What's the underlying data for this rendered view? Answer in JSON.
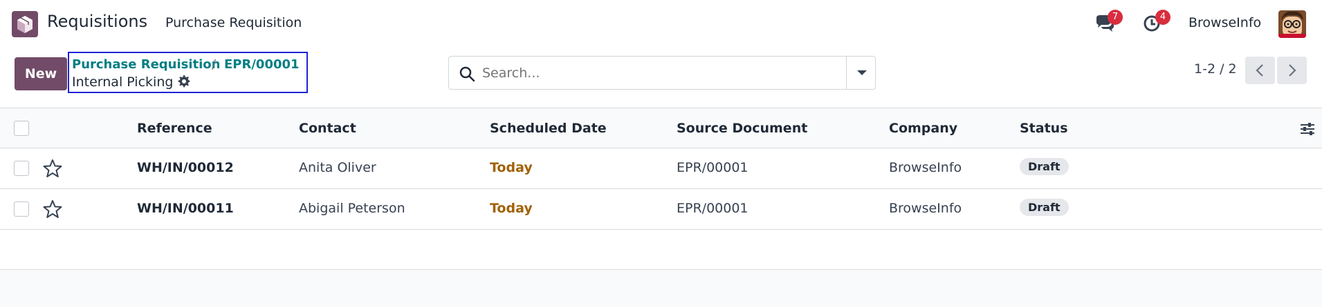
{
  "navbar": {
    "app_name": "Requisitions",
    "menu_item": "Purchase Requisition",
    "messages_count": "7",
    "activities_count": "4",
    "user_name": "BrowseInfo",
    "logo_icon": "cube-box-icon",
    "colors": {
      "brand": "#714b67",
      "badge": "#d92d3e"
    }
  },
  "control_panel": {
    "new_label": "New",
    "breadcrumb": {
      "parent": "Purchase Requisition",
      "separator": "/",
      "record": "EPR/00001",
      "current": "Internal Picking"
    },
    "search": {
      "placeholder": "Search...",
      "value": ""
    },
    "pager": {
      "value": "1-2 / 2"
    }
  },
  "table": {
    "columns": [
      "Reference",
      "Contact",
      "Scheduled Date",
      "Source Document",
      "Company",
      "Status"
    ],
    "rows": [
      {
        "reference": "WH/IN/00012",
        "contact": "Anita Oliver",
        "scheduled_date": "Today",
        "source_document": "EPR/00001",
        "company": "BrowseInfo",
        "status": "Draft"
      },
      {
        "reference": "WH/IN/00011",
        "contact": "Abigail Peterson",
        "scheduled_date": "Today",
        "source_document": "EPR/00001",
        "company": "BrowseInfo",
        "status": "Draft"
      }
    ],
    "colors": {
      "date_today": "#a16207",
      "link": "#017e84"
    }
  }
}
